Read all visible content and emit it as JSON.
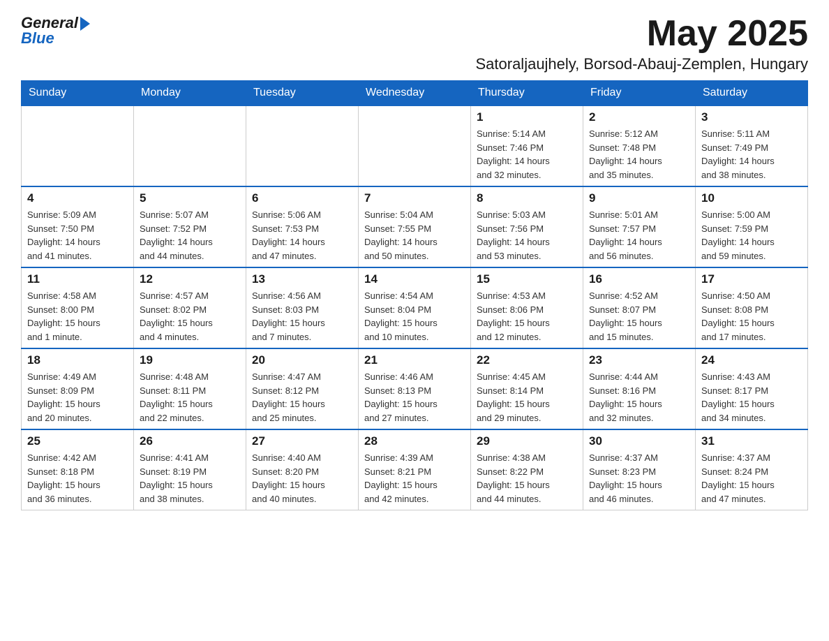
{
  "logo": {
    "general": "General",
    "blue": "Blue"
  },
  "header": {
    "month": "May 2025",
    "location": "Satoraljaujhely, Borsod-Abauj-Zemplen, Hungary"
  },
  "weekdays": [
    "Sunday",
    "Monday",
    "Tuesday",
    "Wednesday",
    "Thursday",
    "Friday",
    "Saturday"
  ],
  "weeks": [
    [
      {
        "day": "",
        "info": ""
      },
      {
        "day": "",
        "info": ""
      },
      {
        "day": "",
        "info": ""
      },
      {
        "day": "",
        "info": ""
      },
      {
        "day": "1",
        "info": "Sunrise: 5:14 AM\nSunset: 7:46 PM\nDaylight: 14 hours\nand 32 minutes."
      },
      {
        "day": "2",
        "info": "Sunrise: 5:12 AM\nSunset: 7:48 PM\nDaylight: 14 hours\nand 35 minutes."
      },
      {
        "day": "3",
        "info": "Sunrise: 5:11 AM\nSunset: 7:49 PM\nDaylight: 14 hours\nand 38 minutes."
      }
    ],
    [
      {
        "day": "4",
        "info": "Sunrise: 5:09 AM\nSunset: 7:50 PM\nDaylight: 14 hours\nand 41 minutes."
      },
      {
        "day": "5",
        "info": "Sunrise: 5:07 AM\nSunset: 7:52 PM\nDaylight: 14 hours\nand 44 minutes."
      },
      {
        "day": "6",
        "info": "Sunrise: 5:06 AM\nSunset: 7:53 PM\nDaylight: 14 hours\nand 47 minutes."
      },
      {
        "day": "7",
        "info": "Sunrise: 5:04 AM\nSunset: 7:55 PM\nDaylight: 14 hours\nand 50 minutes."
      },
      {
        "day": "8",
        "info": "Sunrise: 5:03 AM\nSunset: 7:56 PM\nDaylight: 14 hours\nand 53 minutes."
      },
      {
        "day": "9",
        "info": "Sunrise: 5:01 AM\nSunset: 7:57 PM\nDaylight: 14 hours\nand 56 minutes."
      },
      {
        "day": "10",
        "info": "Sunrise: 5:00 AM\nSunset: 7:59 PM\nDaylight: 14 hours\nand 59 minutes."
      }
    ],
    [
      {
        "day": "11",
        "info": "Sunrise: 4:58 AM\nSunset: 8:00 PM\nDaylight: 15 hours\nand 1 minute."
      },
      {
        "day": "12",
        "info": "Sunrise: 4:57 AM\nSunset: 8:02 PM\nDaylight: 15 hours\nand 4 minutes."
      },
      {
        "day": "13",
        "info": "Sunrise: 4:56 AM\nSunset: 8:03 PM\nDaylight: 15 hours\nand 7 minutes."
      },
      {
        "day": "14",
        "info": "Sunrise: 4:54 AM\nSunset: 8:04 PM\nDaylight: 15 hours\nand 10 minutes."
      },
      {
        "day": "15",
        "info": "Sunrise: 4:53 AM\nSunset: 8:06 PM\nDaylight: 15 hours\nand 12 minutes."
      },
      {
        "day": "16",
        "info": "Sunrise: 4:52 AM\nSunset: 8:07 PM\nDaylight: 15 hours\nand 15 minutes."
      },
      {
        "day": "17",
        "info": "Sunrise: 4:50 AM\nSunset: 8:08 PM\nDaylight: 15 hours\nand 17 minutes."
      }
    ],
    [
      {
        "day": "18",
        "info": "Sunrise: 4:49 AM\nSunset: 8:09 PM\nDaylight: 15 hours\nand 20 minutes."
      },
      {
        "day": "19",
        "info": "Sunrise: 4:48 AM\nSunset: 8:11 PM\nDaylight: 15 hours\nand 22 minutes."
      },
      {
        "day": "20",
        "info": "Sunrise: 4:47 AM\nSunset: 8:12 PM\nDaylight: 15 hours\nand 25 minutes."
      },
      {
        "day": "21",
        "info": "Sunrise: 4:46 AM\nSunset: 8:13 PM\nDaylight: 15 hours\nand 27 minutes."
      },
      {
        "day": "22",
        "info": "Sunrise: 4:45 AM\nSunset: 8:14 PM\nDaylight: 15 hours\nand 29 minutes."
      },
      {
        "day": "23",
        "info": "Sunrise: 4:44 AM\nSunset: 8:16 PM\nDaylight: 15 hours\nand 32 minutes."
      },
      {
        "day": "24",
        "info": "Sunrise: 4:43 AM\nSunset: 8:17 PM\nDaylight: 15 hours\nand 34 minutes."
      }
    ],
    [
      {
        "day": "25",
        "info": "Sunrise: 4:42 AM\nSunset: 8:18 PM\nDaylight: 15 hours\nand 36 minutes."
      },
      {
        "day": "26",
        "info": "Sunrise: 4:41 AM\nSunset: 8:19 PM\nDaylight: 15 hours\nand 38 minutes."
      },
      {
        "day": "27",
        "info": "Sunrise: 4:40 AM\nSunset: 8:20 PM\nDaylight: 15 hours\nand 40 minutes."
      },
      {
        "day": "28",
        "info": "Sunrise: 4:39 AM\nSunset: 8:21 PM\nDaylight: 15 hours\nand 42 minutes."
      },
      {
        "day": "29",
        "info": "Sunrise: 4:38 AM\nSunset: 8:22 PM\nDaylight: 15 hours\nand 44 minutes."
      },
      {
        "day": "30",
        "info": "Sunrise: 4:37 AM\nSunset: 8:23 PM\nDaylight: 15 hours\nand 46 minutes."
      },
      {
        "day": "31",
        "info": "Sunrise: 4:37 AM\nSunset: 8:24 PM\nDaylight: 15 hours\nand 47 minutes."
      }
    ]
  ]
}
